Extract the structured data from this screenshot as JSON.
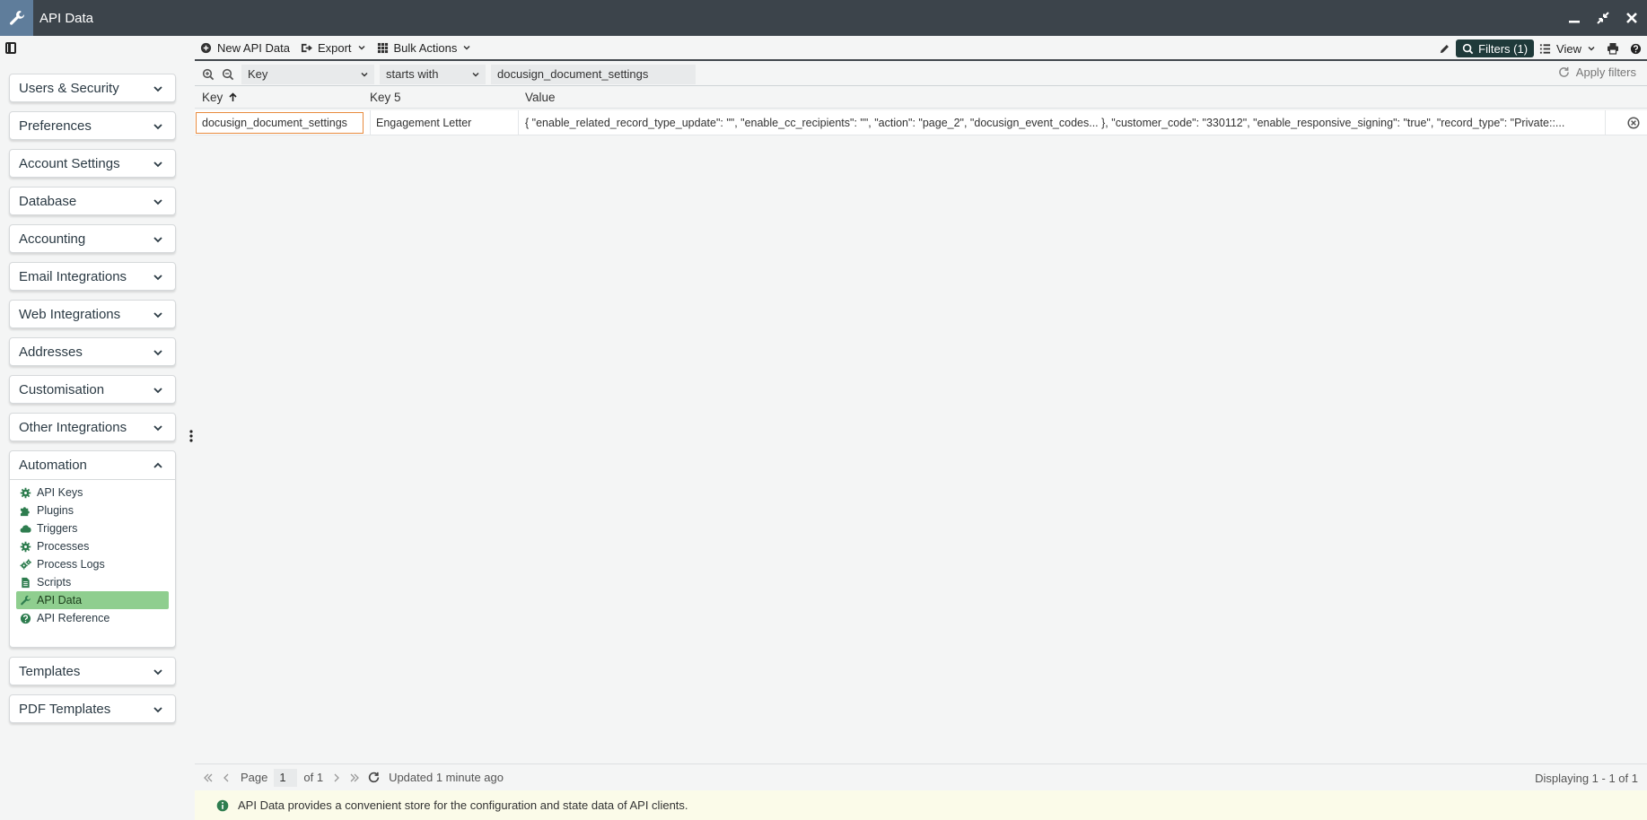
{
  "window": {
    "title": "API Data",
    "icon": "wrench-icon",
    "controls": [
      "minimize-icon",
      "restore-icon",
      "close-icon"
    ]
  },
  "sidebar": {
    "sections": [
      {
        "label": "Users & Security"
      },
      {
        "label": "Preferences"
      },
      {
        "label": "Account Settings"
      },
      {
        "label": "Database"
      },
      {
        "label": "Accounting"
      },
      {
        "label": "Email Integrations"
      },
      {
        "label": "Web Integrations"
      },
      {
        "label": "Addresses"
      },
      {
        "label": "Customisation"
      },
      {
        "label": "Other Integrations"
      }
    ],
    "open_section": {
      "label": "Automation",
      "items": [
        {
          "label": "API Keys",
          "icon": "gear-icon"
        },
        {
          "label": "Plugins",
          "icon": "puzzle-icon"
        },
        {
          "label": "Triggers",
          "icon": "cloud-icon"
        },
        {
          "label": "Processes",
          "icon": "gear-icon"
        },
        {
          "label": "Process Logs",
          "icon": "gears-icon"
        },
        {
          "label": "Scripts",
          "icon": "script-icon"
        },
        {
          "label": "API Data",
          "icon": "wrench-icon",
          "active": true
        },
        {
          "label": "API Reference",
          "icon": "question-circle-icon"
        }
      ]
    },
    "after_sections": [
      {
        "label": "Templates"
      },
      {
        "label": "PDF Templates"
      }
    ]
  },
  "toolbar": {
    "new_label": "New API Data",
    "export_label": "Export",
    "bulk_label": "Bulk Actions",
    "filters_label": "Filters (1)",
    "view_label": "View"
  },
  "filter": {
    "field": "Key",
    "operator": "starts with",
    "value": "docusign_document_settings",
    "apply_label": "Apply filters"
  },
  "grid": {
    "columns": {
      "key": "Key",
      "key5": "Key 5",
      "value": "Value"
    },
    "sort": "ascending",
    "rows": [
      {
        "key": "docusign_document_settings",
        "key5": "Engagement Letter",
        "value": "{ \"enable_related_record_type_update\": \"\", \"enable_cc_recipients\": \"\", \"action\": \"page_2\", \"docusign_event_codes... }, \"customer_code\": \"330112\", \"enable_responsive_signing\": \"true\", \"record_type\": \"Private::..."
      }
    ]
  },
  "pager": {
    "page_label": "Page",
    "page": "1",
    "of_label": "of 1",
    "updated": "Updated 1 minute ago",
    "displaying": "Displaying 1 - 1 of 1"
  },
  "info": {
    "text": "API Data provides a convenient store for the configuration and state data of API clients."
  },
  "colors": {
    "titlebar": "#3c444b",
    "accent_green": "#8fce8f",
    "icon_green": "#2e7d4f",
    "filters_button": "#1f3a3a",
    "selected_cell_border": "#e88a3d",
    "info_bg": "#fbfbe9"
  }
}
